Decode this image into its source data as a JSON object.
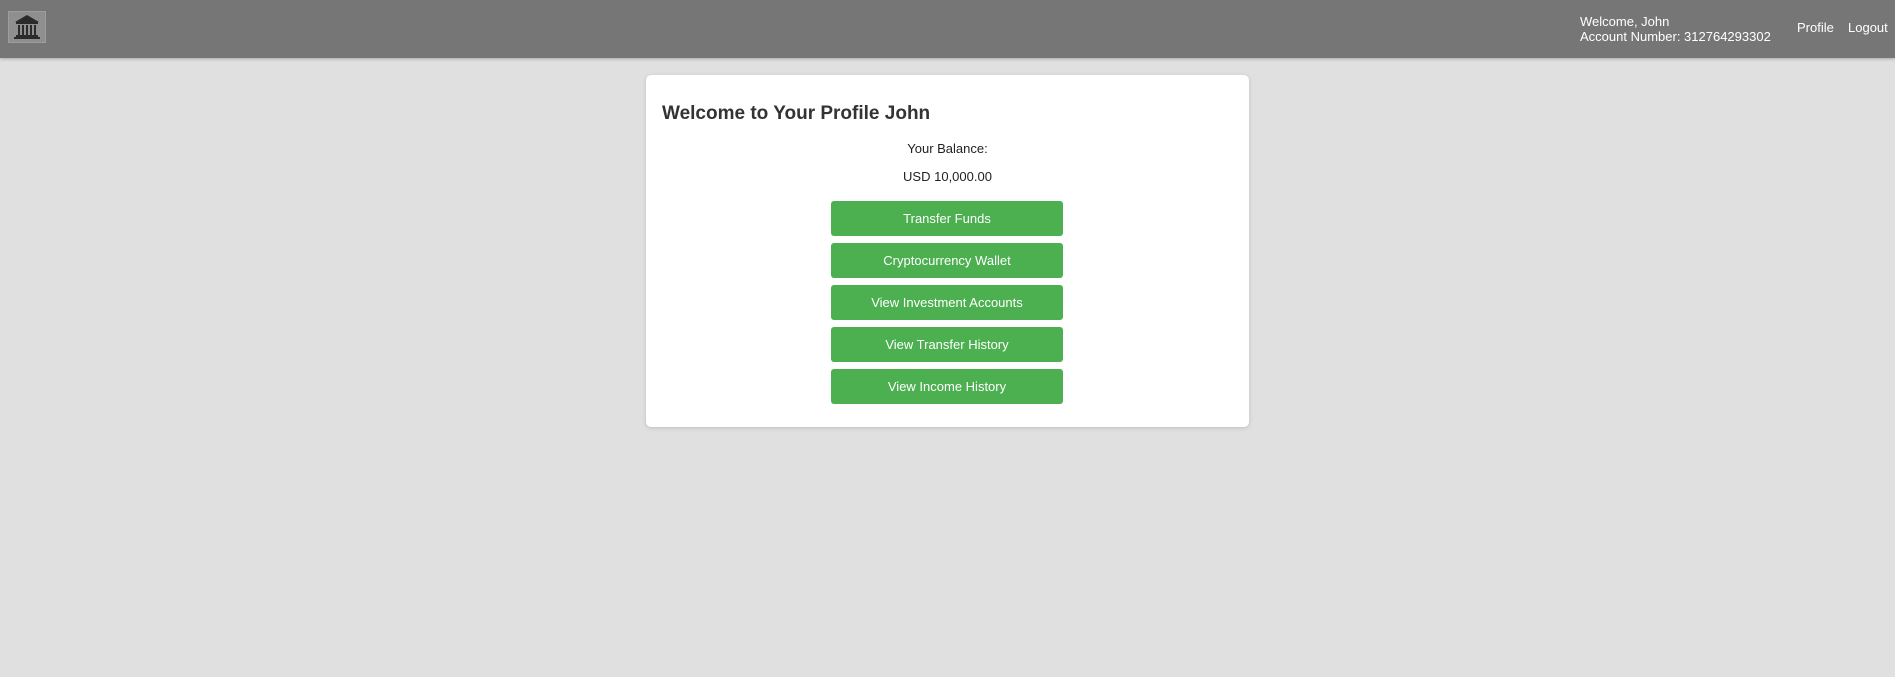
{
  "header": {
    "logo_icon": "bank-icon",
    "welcome_text": "Welcome, John",
    "account_number_text": "Account Number: 312764293302",
    "nav": {
      "profile_label": "Profile",
      "logout_label": "Logout"
    },
    "background_color": "#767676"
  },
  "profile_card": {
    "title": "Welcome to Your Profile John",
    "balance_label": "Your Balance:",
    "balance_value": "USD 10,000.00",
    "actions": [
      {
        "label": "Transfer Funds"
      },
      {
        "label": "Cryptocurrency Wallet"
      },
      {
        "label": "View Investment Accounts"
      },
      {
        "label": "View Transfer History"
      },
      {
        "label": "View Income History"
      }
    ],
    "button_color": "#4caf50"
  },
  "page_background": "#e0e0e0"
}
